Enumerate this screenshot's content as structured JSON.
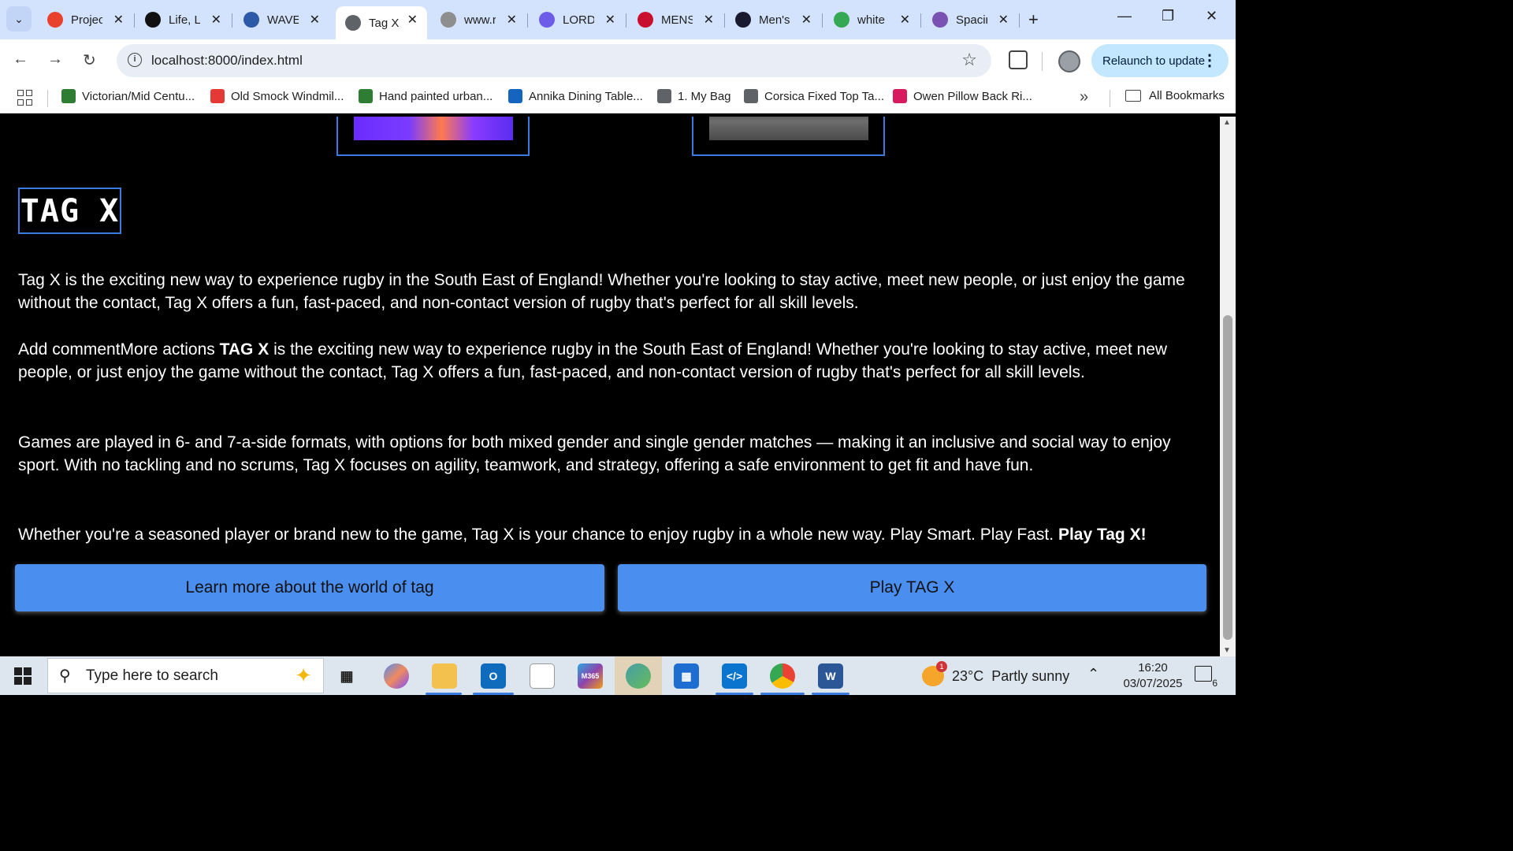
{
  "browser": {
    "tabs": [
      {
        "title": "Projec",
        "icon": "opera-icon",
        "color": "#e8412c"
      },
      {
        "title": "Life, L",
        "icon": "openai-icon",
        "color": "#111111"
      },
      {
        "title": "WAVE",
        "icon": "wave-icon",
        "color": "#2d5aa8"
      },
      {
        "title": "Tag X",
        "icon": "globe-icon",
        "color": "#5f6368",
        "active": true
      },
      {
        "title": "www.r",
        "icon": "rd-icon",
        "color": "#8e8e8e"
      },
      {
        "title": "LORD",
        "icon": "printer-icon",
        "color": "#6c5ce7"
      },
      {
        "title": "MENS",
        "icon": "brand-icon",
        "color": "#c8102e"
      },
      {
        "title": "Men's",
        "icon": "ct-icon",
        "color": "#1a1a2e"
      },
      {
        "title": "white",
        "icon": "google-lens-icon",
        "color": "#34a853"
      },
      {
        "title": "Spacin",
        "icon": "bootstrap-icon",
        "color": "#7952b3"
      }
    ],
    "url": "localhost:8000/index.html",
    "relaunch_label": "Relaunch to update",
    "bookmarks": [
      {
        "label": "Victorian/Mid Centu...",
        "color": "#2e7d32"
      },
      {
        "label": "Old Smock Windmil...",
        "color": "#e53935"
      },
      {
        "label": "Hand painted urban...",
        "color": "#2e7d32"
      },
      {
        "label": "Annika Dining Table...",
        "color": "#1565c0"
      },
      {
        "label": "1. My Bag",
        "color": "#5f6368"
      },
      {
        "label": "Corsica Fixed Top Ta...",
        "color": "#5f6368"
      },
      {
        "label": "Owen Pillow Back Ri...",
        "color": "#d81b60"
      }
    ],
    "all_bookmarks_label": "All Bookmarks"
  },
  "page": {
    "title": "TAG X",
    "para1": "Tag X is the exciting new way to experience rugby in the South East of England! Whether you're looking to stay active, meet new people, or just enjoy the game without the contact, Tag X offers a fun, fast-paced, and non-contact version of rugby that's perfect for all skill levels.",
    "para2_prefix": "Add commentMore actions ",
    "para2_bold": "TAG X",
    "para2_rest": " is the exciting new way to experience rugby in the South East of England! Whether you're looking to stay active, meet new people, or just enjoy the game without the contact, Tag X offers a fun, fast-paced, and non-contact version of rugby that's perfect for all skill levels.",
    "para3": "Games are played in 6- and 7-a-side formats, with options for both mixed gender and single gender matches — making it an inclusive and social way to enjoy sport. With no tackling and no scrums, Tag X focuses on agility, teamwork, and strategy, offering a safe environment to get fit and have fun.",
    "para4_text": "Whether you're a seasoned player or brand new to the game, Tag X is your chance to enjoy rugby in a whole new way. Play Smart. Play Fast. ",
    "para4_bold": "Play Tag X!",
    "button_learn": "Learn more about the world of tag",
    "button_play": "Play TAG X",
    "accent_color": "#4a8ef0"
  },
  "taskbar": {
    "search_placeholder": "Type here to search",
    "weather": "23°C  Partly sunny",
    "weather_badge": "1",
    "time": "16:20",
    "date": "03/07/2025",
    "notifications": "6"
  }
}
